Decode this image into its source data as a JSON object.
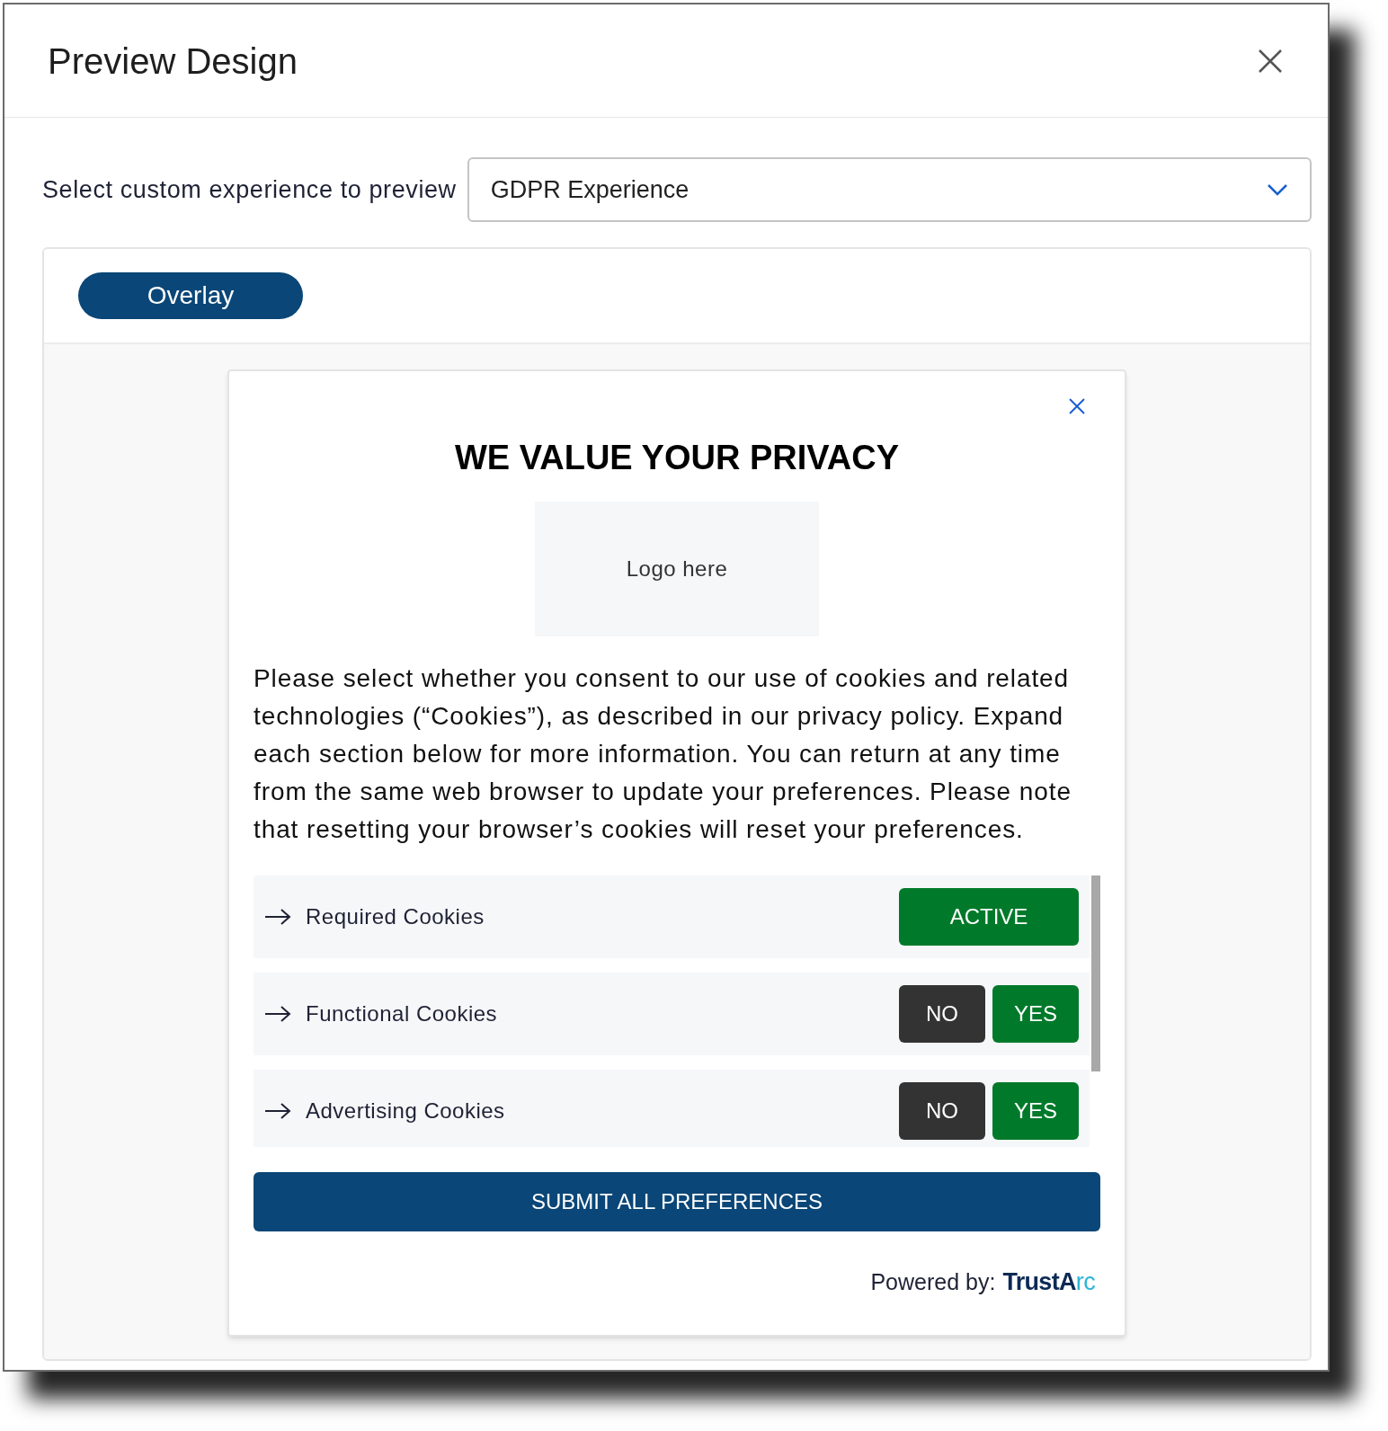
{
  "dialog": {
    "title": "Preview Design"
  },
  "selector": {
    "label": "Select custom experience to preview",
    "value": "GDPR Experience"
  },
  "tabs": [
    {
      "label": "Overlay",
      "selected": true
    }
  ],
  "banner": {
    "heading": "WE VALUE YOUR PRIVACY",
    "logo_placeholder": "Logo here",
    "body": "Please select whether you consent to our use of cookies and related technologies (“Cookies”), as described in our privacy policy. Expand each section below for more information. You can return at any time from the same web browser to update your preferences. Please note that resetting your browser’s cookies will reset your preferences.",
    "categories": [
      {
        "kind": "fixed",
        "label": "Required Cookies",
        "buttons": [
          "ACTIVE"
        ]
      },
      {
        "kind": "choice",
        "label": "Functional Cookies",
        "buttons": [
          "NO",
          "YES"
        ]
      },
      {
        "kind": "choice",
        "label": "Advertising Cookies",
        "buttons": [
          "NO",
          "YES"
        ]
      }
    ],
    "submit": "SUBMIT ALL PREFERENCES",
    "powered_by": "Powered by:",
    "brand_main": "TrustA",
    "brand_accent": "rc"
  }
}
